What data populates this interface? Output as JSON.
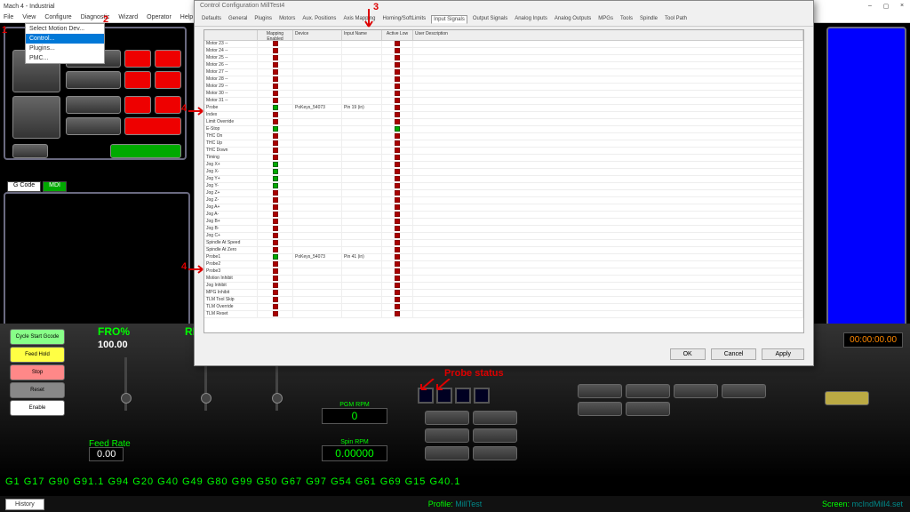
{
  "window": {
    "title": "Mach 4 - Industrial",
    "min": "–",
    "max": "▢",
    "close": "×"
  },
  "menu": [
    "File",
    "View",
    "Configure",
    "Diagnostic",
    "Wizard",
    "Operator",
    "Help"
  ],
  "configure_dropdown": {
    "items": [
      "Select Motion Dev...",
      "Control...",
      "Plugins...",
      "PMC..."
    ],
    "highlight": 1
  },
  "gcode_tabs": {
    "active": "G Code",
    "inactive": "MDI"
  },
  "dialog": {
    "title": "Control Configuration MillTest4",
    "tabs": [
      "Defaults",
      "General",
      "Plugins",
      "Motors",
      "Aux. Positions",
      "Axis Mapping",
      "Homing/SoftLimits",
      "Input Signals",
      "Output Signals",
      "Analog Inputs",
      "Analog Outputs",
      "MPGs",
      "Tools",
      "Spindle",
      "Tool Path"
    ],
    "active_tab": 7,
    "columns": [
      "",
      "Mapping Enabled",
      "Device",
      "Input Name",
      "Active Low",
      "User Description"
    ],
    "rows": [
      {
        "name": "Motor 23 --",
        "en": "r",
        "al": "r"
      },
      {
        "name": "Motor 24 --",
        "en": "r",
        "al": "r"
      },
      {
        "name": "Motor 25 --",
        "en": "r",
        "al": "r"
      },
      {
        "name": "Motor 26 --",
        "en": "r",
        "al": "r"
      },
      {
        "name": "Motor 27 --",
        "en": "r",
        "al": "r"
      },
      {
        "name": "Motor 28 --",
        "en": "r",
        "al": "r"
      },
      {
        "name": "Motor 29 --",
        "en": "r",
        "al": "r"
      },
      {
        "name": "Motor 30 --",
        "en": "r",
        "al": "r"
      },
      {
        "name": "Motor 31 --",
        "en": "r",
        "al": "r"
      },
      {
        "name": "Probe",
        "en": "g",
        "dev": "PoKeys_54073",
        "inp": "Pin 19 (in)",
        "al": "r"
      },
      {
        "name": "Index",
        "en": "r",
        "al": "r"
      },
      {
        "name": "Limit Override",
        "en": "r",
        "al": "r"
      },
      {
        "name": "E-Stop",
        "en": "g",
        "al": "g"
      },
      {
        "name": "THC On",
        "en": "r",
        "al": "r"
      },
      {
        "name": "THC Up",
        "en": "r",
        "al": "r"
      },
      {
        "name": "THC Down",
        "en": "r",
        "al": "r"
      },
      {
        "name": "Timing",
        "en": "r",
        "al": "r"
      },
      {
        "name": "Jog X+",
        "en": "g",
        "al": "r"
      },
      {
        "name": "Jog X-",
        "en": "g",
        "al": "r"
      },
      {
        "name": "Jog Y+",
        "en": "g",
        "al": "r"
      },
      {
        "name": "Jog Y-",
        "en": "g",
        "al": "r"
      },
      {
        "name": "Jog Z+",
        "en": "r",
        "al": "r"
      },
      {
        "name": "Jog Z-",
        "en": "r",
        "al": "r"
      },
      {
        "name": "Jog A+",
        "en": "r",
        "al": "r"
      },
      {
        "name": "Jog A-",
        "en": "r",
        "al": "r"
      },
      {
        "name": "Jog B+",
        "en": "r",
        "al": "r"
      },
      {
        "name": "Jog B-",
        "en": "r",
        "al": "r"
      },
      {
        "name": "Jog C+",
        "en": "r",
        "al": "r"
      },
      {
        "name": "Spindle At Speed",
        "en": "r",
        "al": "r"
      },
      {
        "name": "Spindle At Zero",
        "en": "r",
        "al": "r"
      },
      {
        "name": "Probe1",
        "en": "g",
        "dev": "PoKeys_54073",
        "inp": "Pin 41 (in)",
        "al": "r"
      },
      {
        "name": "Probe2",
        "en": "r",
        "al": "r"
      },
      {
        "name": "Probe3",
        "en": "r",
        "al": "r"
      },
      {
        "name": "Motion Inhibit",
        "en": "r",
        "al": "r"
      },
      {
        "name": "Jog Inhibit",
        "en": "r",
        "al": "r"
      },
      {
        "name": "MPG Inhibit",
        "en": "r",
        "al": "r"
      },
      {
        "name": "TLM Tool Skip",
        "en": "r",
        "al": "r"
      },
      {
        "name": "TLM Override",
        "en": "r",
        "al": "r"
      },
      {
        "name": "TLM Reset",
        "en": "r",
        "al": "r"
      }
    ],
    "buttons": {
      "ok": "OK",
      "cancel": "Cancel",
      "apply": "Apply"
    }
  },
  "controls": {
    "left_buttons": [
      "Cycle Start Gcode",
      "Feed Hold",
      "Stop",
      "Reset",
      "Enable"
    ],
    "fro": {
      "label": "FRO%",
      "value": "100.00"
    },
    "rr": {
      "label": "RR"
    },
    "feed": {
      "label": "Feed Rate",
      "value": "0.00"
    },
    "pgm": {
      "label": "PGM RPM",
      "value": "0"
    },
    "spin": {
      "label": "Spin RPM",
      "value": "0.00000"
    },
    "time": "00:00:00.00"
  },
  "gcodes": "G1 G17 G90 G91.1 G94 G20 G40 G49 G80 G99 G50 G67 G97 G54 G61 G69 G15 G40.1",
  "status": {
    "history": "History",
    "profile_label": "Profile:",
    "profile": "MillTest",
    "screen_label": "Screen:",
    "screen": "mcIndMill4.set"
  },
  "annotations": {
    "a1": "1",
    "a2": "2",
    "a3": "3",
    "a4": "4",
    "probe": "Probe status"
  }
}
